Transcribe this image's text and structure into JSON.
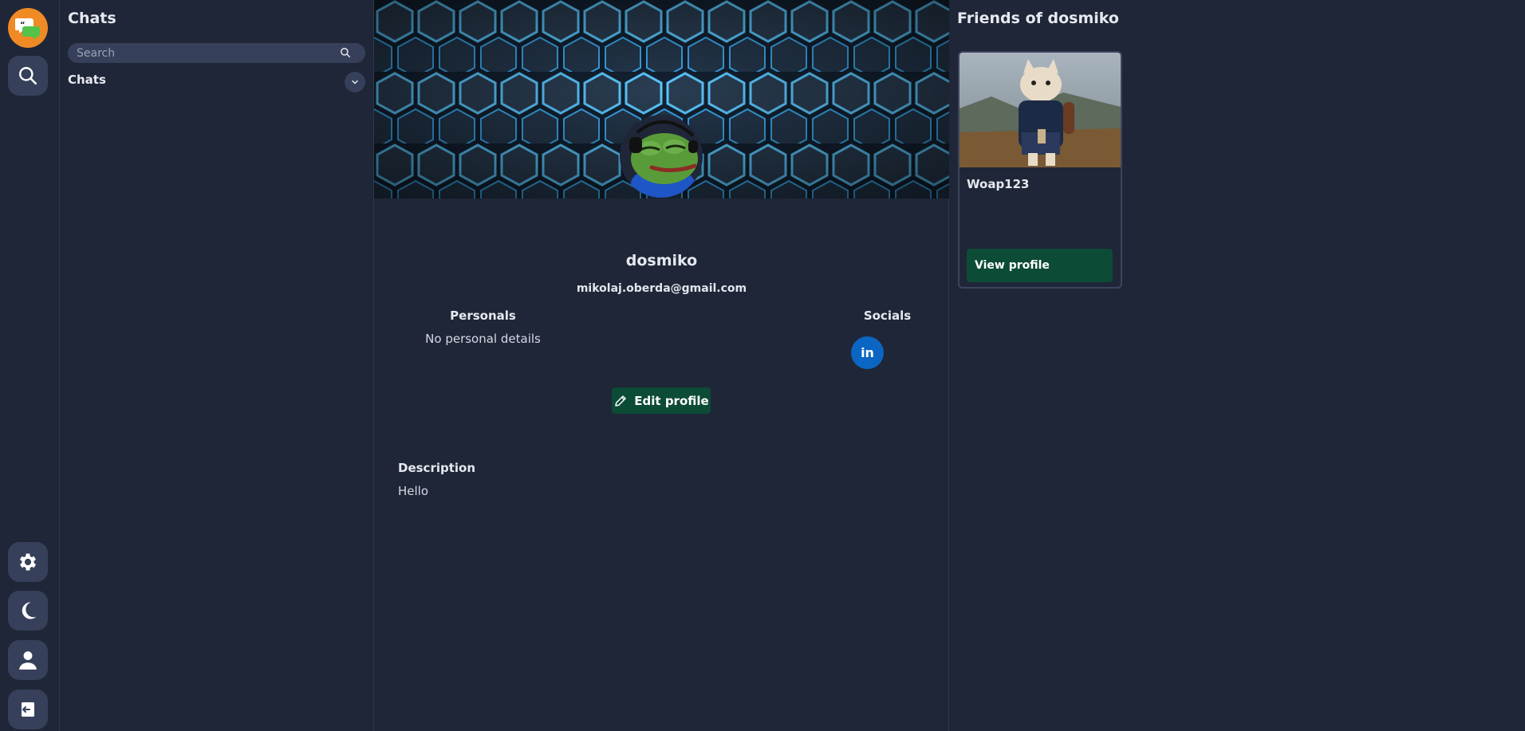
{
  "rail": {
    "top_icons": [
      "chat-logo-icon",
      "search-icon"
    ],
    "bottom_icons": [
      "gear-icon",
      "moon-icon",
      "user-icon",
      "logout-icon"
    ]
  },
  "sidebar": {
    "title": "Chats",
    "search_placeholder": "Search",
    "section_label": "Chats"
  },
  "profile": {
    "username": "dosmiko",
    "email": "mikolaj.oberda@gmail.com",
    "personals_label": "Personals",
    "personals_value": "No personal details",
    "socials_label": "Socials",
    "social_links": [
      {
        "name": "linkedin-icon",
        "text": "in",
        "color": "#0a66c2"
      }
    ],
    "edit_label": "Edit profile",
    "description_label": "Description",
    "description_value": "Hello"
  },
  "friends": {
    "title": "Friends of dosmiko",
    "items": [
      {
        "name": "Woap123",
        "button_label": "View profile"
      }
    ]
  },
  "colors": {
    "background": "#1f2638",
    "accent_green": "#0c4b35",
    "logo_orange": "#f08a24",
    "button_bg": "#37405a"
  }
}
